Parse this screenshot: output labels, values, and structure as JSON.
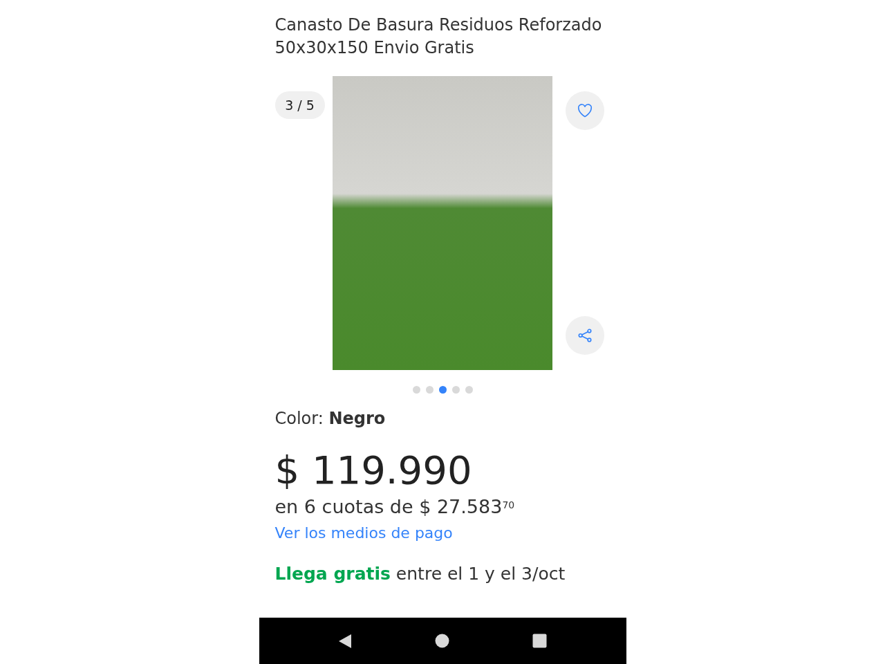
{
  "product": {
    "title": "Canasto De Basura Residuos Reforzado 50x30x150 Envio Gratis"
  },
  "gallery": {
    "counter": "3 / 5",
    "dots": [
      {
        "selected": false
      },
      {
        "selected": false
      },
      {
        "selected": true
      },
      {
        "selected": false
      },
      {
        "selected": false
      }
    ]
  },
  "color": {
    "text": "Color: **Negro**"
  },
  "price": {
    "amount": "$ 119.990",
    "installments": "en 6 cuotas de $ 27.583$^{70}$",
    "payment_link": "Ver los medios de pago"
  },
  "shipping": {
    "text": "**Llega gratis** entre el 1 y el 3/oct"
  }
}
